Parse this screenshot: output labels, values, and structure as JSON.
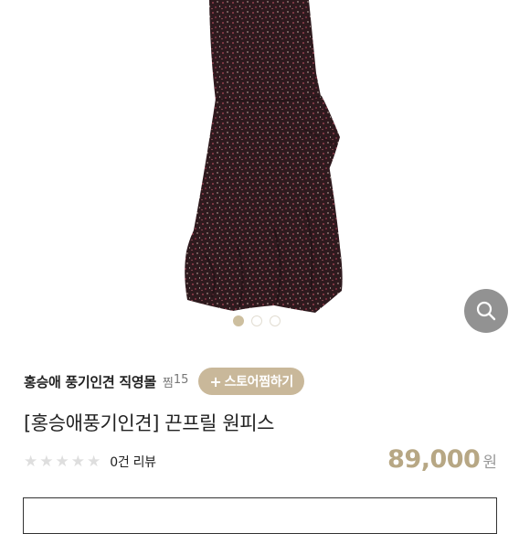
{
  "gallery": {
    "image_alt": "product-photo",
    "slide_count": 3,
    "active_slide": 0,
    "zoom_icon": "search-icon"
  },
  "store": {
    "name": "홍승애 풍기인견 직영몰",
    "likes_label": "찜",
    "likes_count": "15",
    "favorite_button_plus": "+",
    "favorite_button_label": "스토어찜하기"
  },
  "product": {
    "title": "[홍승애풍기인견] 끈프릴 원피스",
    "rating_stars": 0,
    "review_count": "0건",
    "review_label": "리뷰",
    "price": "89,000",
    "currency": "원"
  },
  "colors": {
    "accent": "#c9b89a",
    "price": "#b7a784",
    "dress": "#2e1a1e"
  }
}
